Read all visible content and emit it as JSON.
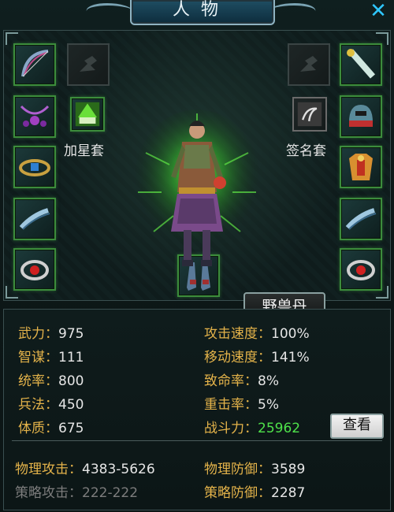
{
  "window": {
    "title": "人物"
  },
  "equipment": {
    "set_left_label": "加星套",
    "set_right_label": "签名套",
    "beast_button_label": "野兽丹"
  },
  "stats": {
    "wuli": {
      "label": "武力",
      "value": "975"
    },
    "zhimou": {
      "label": "智谋",
      "value": "111"
    },
    "tonglv": {
      "label": "统率",
      "value": "800"
    },
    "bingfa": {
      "label": "兵法",
      "value": "450"
    },
    "tizhi": {
      "label": "体质",
      "value": "675"
    },
    "attack_speed": {
      "label": "攻击速度",
      "value": "100%"
    },
    "move_speed": {
      "label": "移动速度",
      "value": "141%"
    },
    "crit_rate": {
      "label": "致命率",
      "value": "8%"
    },
    "heavy_rate": {
      "label": "重击率",
      "value": "5%"
    },
    "combat_power": {
      "label": "战斗力",
      "value": "25962"
    },
    "view_button_label": "查看",
    "phys_attack": {
      "label": "物理攻击",
      "value": "4383-5626"
    },
    "phys_defense": {
      "label": "物理防御",
      "value": "3589"
    },
    "strat_attack": {
      "label": "策略攻击",
      "value": "222-222"
    },
    "strat_defense": {
      "label": "策略防御",
      "value": "2287"
    }
  },
  "colors": {
    "stat_label": "#e4b34a",
    "stat_value": "#e6e6e6",
    "combat_power": "#4ee24a",
    "close_icon": "#2fc7ff",
    "slot_border": "#3c8c3c"
  },
  "icons": {
    "close": "close-icon",
    "slots": [
      "bow-icon",
      "empty-slot",
      "empty-slot",
      "scroll-icon",
      "necklace-icon",
      "star-set-icon",
      "signature-set-icon",
      "helmet-icon",
      "belt-icon",
      "armor-icon",
      "bracer-icon",
      "bracer-icon",
      "ring-icon",
      "boots-icon",
      "ring-icon"
    ]
  }
}
